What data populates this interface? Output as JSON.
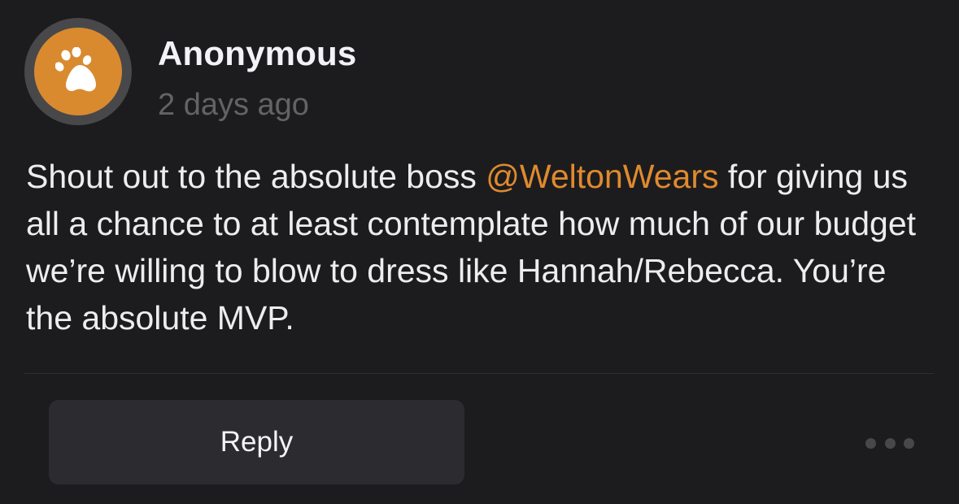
{
  "post": {
    "author": "Anonymous",
    "timestamp": "2 days ago",
    "avatar_icon": "paw-icon",
    "body_before": "Shout out to the absolute boss ",
    "mention": "@WeltonWears",
    "body_after": " for giving us all a chance to at least contemplate how much of our budget we’re willing to blow to dress like Hannah/Rebecca. You’re the absolute MVP."
  },
  "actions": {
    "reply_label": "Reply",
    "more_icon": "more-dots-icon"
  },
  "colors": {
    "background": "#1c1c1e",
    "avatar": "#d98a2f",
    "mention": "#e08a2e",
    "timestamp": "#636366",
    "button": "#2c2c30"
  }
}
